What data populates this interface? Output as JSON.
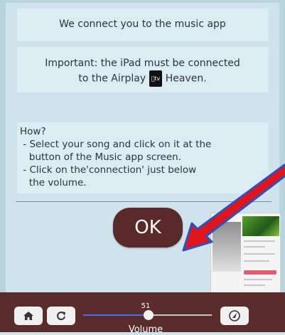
{
  "intro": {
    "line1": "We connect you to the music app",
    "important_before": "Important: the iPad must be connected",
    "important_after": "to the Airplay",
    "heaven": "Heaven.",
    "appletv_label": "tv"
  },
  "how": {
    "title": "How?",
    "text": " - Select your song and click on it at the\n   button of the Music app screen.\n - Click on the'connection' just below\n   the volume."
  },
  "ok_label": "OK",
  "volume": {
    "value": "51",
    "label": "Volume",
    "level": 0.51
  },
  "colors": {
    "bar_bg": "#5b2c2c",
    "ok_bg": "#5a2a2a",
    "arrow_red": "#e0141a"
  }
}
